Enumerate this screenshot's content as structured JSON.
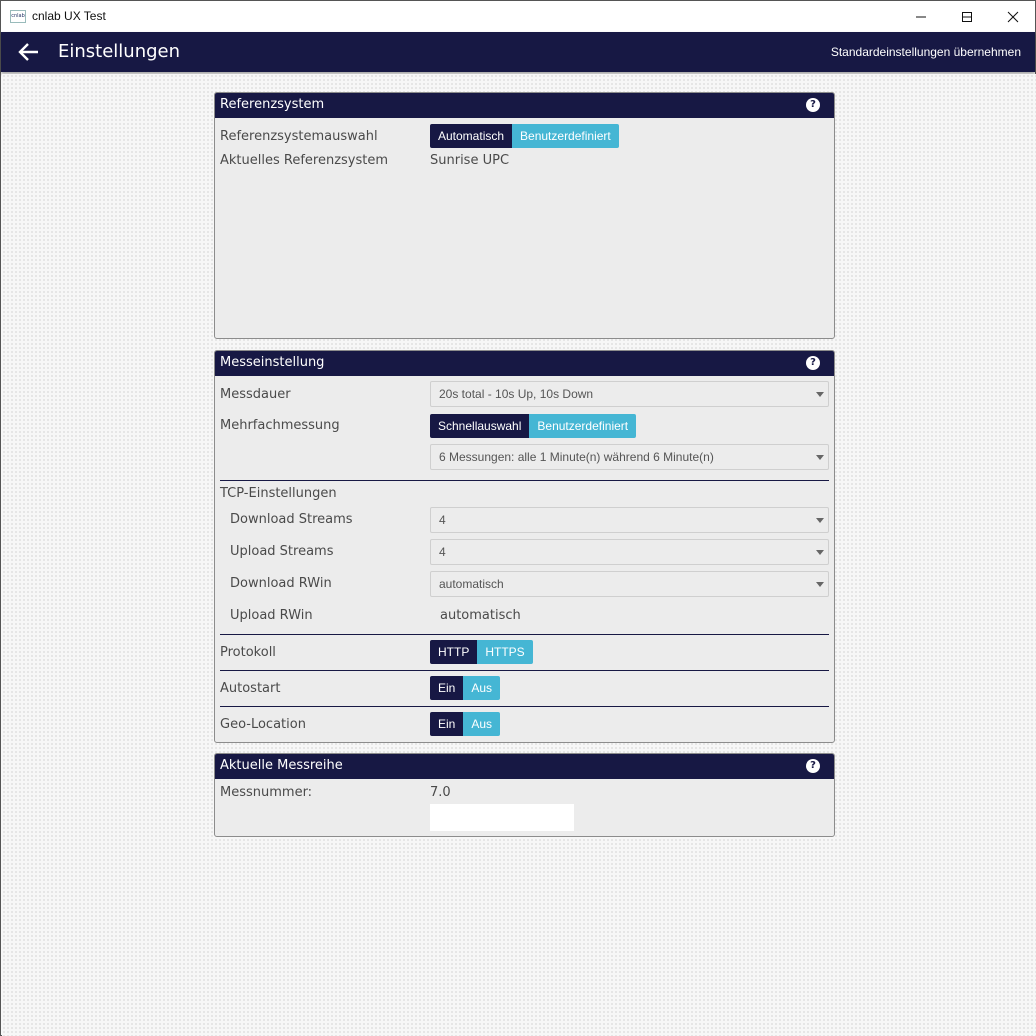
{
  "window": {
    "title": "cnlab UX Test",
    "app_icon_text": "cnlab"
  },
  "appbar": {
    "title": "Einstellungen",
    "reset_label": "Standardeinstellungen übernehmen"
  },
  "panels": {
    "referenz": {
      "title": "Referenzsystem",
      "help": "?",
      "auswahl_label": "Referenzsystemauswahl",
      "auswahl_options": [
        "Automatisch",
        "Benutzerdefiniert"
      ],
      "aktuell_label": "Aktuelles Referenzsystem",
      "aktuell_value": "Sunrise UPC"
    },
    "messe": {
      "title": "Messeinstellung",
      "help": "?",
      "messdauer_label": "Messdauer",
      "messdauer_value": "20s total - 10s Up, 10s Down",
      "mehrfach_label": "Mehrfachmessung",
      "mehrfach_options": [
        "Schnellauswahl",
        "Benutzerdefiniert"
      ],
      "mehrfach_value": "6 Messungen: alle 1 Minute(n) während 6 Minute(n)",
      "tcp_label": "TCP-Einstellungen",
      "download_streams_label": "Download Streams",
      "download_streams_value": "4",
      "upload_streams_label": "Upload Streams",
      "upload_streams_value": "4",
      "download_rwin_label": "Download RWin",
      "download_rwin_value": "automatisch",
      "upload_rwin_label": "Upload RWin",
      "upload_rwin_value": "automatisch",
      "protokoll_label": "Protokoll",
      "protokoll_options": [
        "HTTP",
        "HTTPS"
      ],
      "autostart_label": "Autostart",
      "autostart_options": [
        "Ein",
        "Aus"
      ],
      "geo_label": "Geo-Location",
      "geo_options": [
        "Ein",
        "Aus"
      ]
    },
    "messreihe": {
      "title": "Aktuelle Messreihe",
      "help": "?",
      "messnummer_label": "Messnummer:",
      "messnummer_value": "7.0",
      "messnummer_input": ""
    }
  },
  "colors": {
    "primary": "#171844",
    "accent": "#45b6d4",
    "panel_bg": "#ececec"
  },
  "icons": {
    "back": "arrow-left-icon",
    "help": "question-circle-icon",
    "dropdown": "chevron-down-icon"
  }
}
